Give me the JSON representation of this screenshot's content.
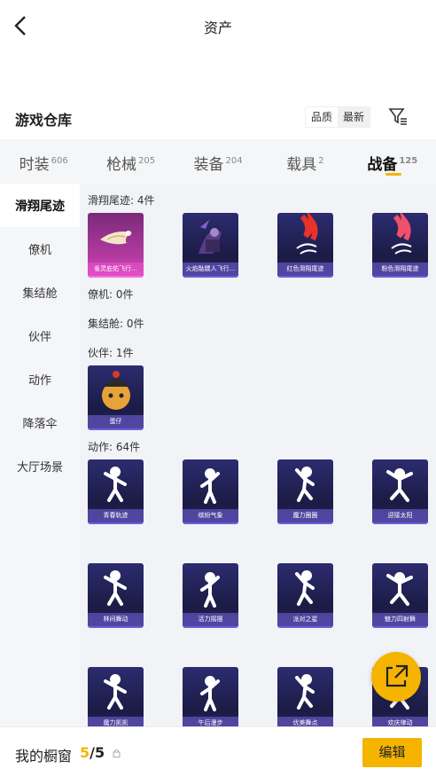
{
  "header": {
    "title": "资产"
  },
  "warehouse": {
    "title": "游戏仓库",
    "sort_options": [
      "品质",
      "最新"
    ],
    "filter_icon": "filter-icon"
  },
  "tabs": [
    {
      "label": "时装",
      "count": "606"
    },
    {
      "label": "枪械",
      "count": "205"
    },
    {
      "label": "装备",
      "count": "204"
    },
    {
      "label": "载具",
      "count": "2"
    },
    {
      "label": "战备",
      "count": "125",
      "active": true
    }
  ],
  "sidebar": [
    {
      "label": "滑翔尾迹",
      "active": true
    },
    {
      "label": "僚机"
    },
    {
      "label": "集结舱"
    },
    {
      "label": "伙伴"
    },
    {
      "label": "动作"
    },
    {
      "label": "降落伞"
    },
    {
      "label": "大厅场景"
    }
  ],
  "sections": {
    "glide": {
      "title": "滑翔尾迹: 4件",
      "items": [
        "雀灵庇佑飞行...",
        "火焰骷髅人飞行...",
        "红色滑翔尾迹",
        "粉色滑翔尾迹"
      ]
    },
    "wingman": {
      "title": "僚机: 0件"
    },
    "pod": {
      "title": "集结舱: 0件"
    },
    "partner": {
      "title": "伙伴: 1件",
      "items": [
        "蛋仔"
      ]
    },
    "emote": {
      "title": "动作: 64件",
      "items": [
        "青春轨迹",
        "缤纷气象",
        "魔力圈圈",
        "迎接太阳",
        "林间舞动",
        "活力摇摆",
        "派对之星",
        "魅力四射舞",
        "魔力凯凯",
        "午后漫步",
        "优美舞点",
        "欢庆律动"
      ]
    }
  },
  "bottom": {
    "label": "我的橱窗",
    "current": "5",
    "total": "/5",
    "edit_label": "编辑"
  },
  "colors": {
    "accent": "#f5b400",
    "card_dark": "#1b1b44",
    "card_pink": "#b43aa0"
  }
}
